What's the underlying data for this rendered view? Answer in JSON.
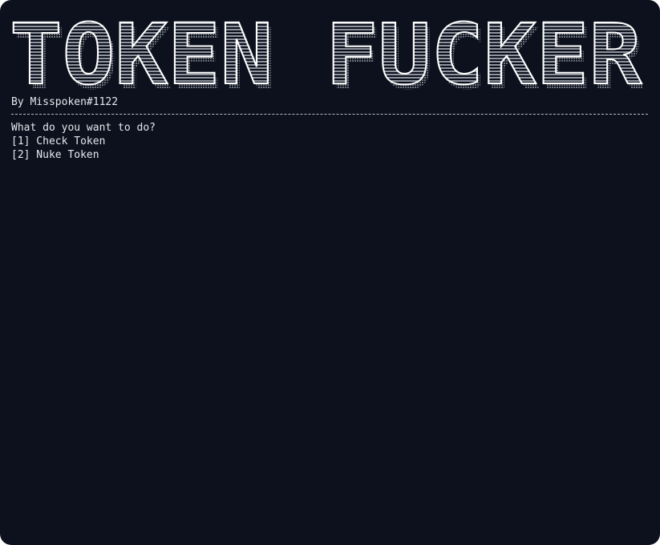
{
  "banner": {
    "text": "TOKEN FUCKER"
  },
  "author": "By Misspoken#1122",
  "divider": "-----------------------------------------------------------------------------------------------",
  "menu": {
    "prompt": "What do you want to do?",
    "options": [
      {
        "label": "[1] Check Token"
      },
      {
        "label": "[2] Nuke Token"
      }
    ]
  },
  "colors": {
    "background": "#0d111d",
    "text": "#e6e8ef",
    "banner_fill": "#ffffff",
    "banner_shadow": "#9a9ea8"
  }
}
